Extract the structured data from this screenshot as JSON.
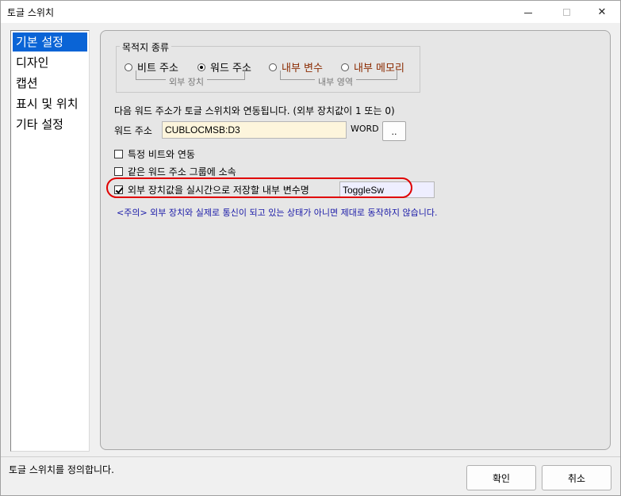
{
  "window": {
    "title": "토글 스위치"
  },
  "nav": {
    "items": [
      {
        "label": "기본 설정",
        "selected": true
      },
      {
        "label": "디자인",
        "selected": false
      },
      {
        "label": "캡션",
        "selected": false
      },
      {
        "label": "표시 및 위치",
        "selected": false
      },
      {
        "label": "기타 설정",
        "selected": false
      }
    ]
  },
  "destination": {
    "caption": "목적지 종류",
    "options": [
      {
        "label": "비트 주소",
        "checked": false
      },
      {
        "label": "워드 주소",
        "checked": true
      },
      {
        "label": "내부 변수",
        "checked": false
      },
      {
        "label": "내부 메모리",
        "checked": false
      }
    ],
    "external_caption": "외부 장치",
    "internal_caption": "내부 영역"
  },
  "description": "다음 워드 주소가 토글 스위치와 연동됩니다. (외부 장치값이 1 또는 0)",
  "word_address": {
    "label": "워드 주소",
    "value": "CUBLOCMSB:D3",
    "unit": "WORD",
    "browse_label": ".."
  },
  "options": {
    "specific_bit": {
      "label": "특정 비트와 연동",
      "checked": false
    },
    "same_group": {
      "label": "같은 워드 주소 그룹에 소속",
      "checked": false
    },
    "store_realtime": {
      "label": "외부 장치값을 실시간으로 저장할 내부 변수명",
      "checked": true,
      "var_name": "ToggleSw"
    }
  },
  "warning": "<주의> 외부 장치와 실제로 통신이 되고 있는 상태가 아니면 제대로 동작하지 않습니다.",
  "status": "토글 스위치를 정의합니다.",
  "buttons": {
    "ok": "확인",
    "cancel": "취소"
  },
  "colors": {
    "selected_nav": "#0a64d6",
    "highlight": "#e00000",
    "warning_text": "#1a1aa8",
    "internal_option": "#8a2a00"
  }
}
